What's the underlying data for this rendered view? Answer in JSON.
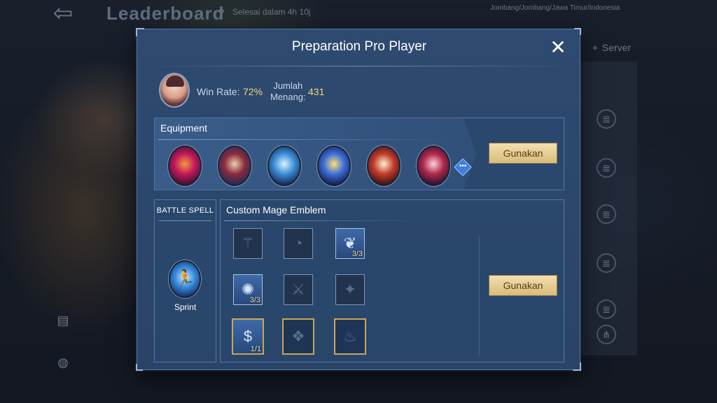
{
  "background": {
    "title": "Leaderboard",
    "timer": "Selesai dalam 4h 10j",
    "location": "Jombang/Jombang/Jawa Timur/Indonesia",
    "server_label": "Server",
    "partial_label": "g"
  },
  "modal": {
    "title": "Preparation Pro Player",
    "close_label": "✕"
  },
  "player": {
    "win_rate_label": "Win Rate:",
    "win_rate_value": "72%",
    "wins_label_line1": "Jumlah",
    "wins_label_line2": "Menang:",
    "wins_value": "431"
  },
  "equipment": {
    "title": "Equipment",
    "items": [
      {
        "icon": "wand-item-icon"
      },
      {
        "icon": "spellbook-item-icon"
      },
      {
        "icon": "ice-sword-item-icon"
      },
      {
        "icon": "golden-staff-item-icon"
      },
      {
        "icon": "helmet-item-icon"
      },
      {
        "icon": "blade-item-icon"
      }
    ],
    "more_label": "•••",
    "use_button": "Gunakan"
  },
  "battle_spell": {
    "title": "BATTLE SPELL",
    "spell_name": "Sprint",
    "spell_glyph": "🏃"
  },
  "emblem": {
    "title": "Custom Mage Emblem",
    "use_button": "Gunakan",
    "talents": [
      {
        "icon": "staff-talent-icon",
        "glyph": "⚚",
        "active": false,
        "level": ""
      },
      {
        "icon": "cycle-talent-icon",
        "glyph": "◔",
        "active": false,
        "level": ""
      },
      {
        "icon": "wing-talent-icon",
        "glyph": "❦",
        "active": true,
        "level": "3/3"
      },
      {
        "icon": "burst-talent-icon",
        "glyph": "✺",
        "active": true,
        "level": "3/3"
      },
      {
        "icon": "sword-talent-icon",
        "glyph": "⚔",
        "active": false,
        "level": ""
      },
      {
        "icon": "fist-talent-icon",
        "glyph": "✦",
        "active": false,
        "level": ""
      },
      {
        "icon": "money-bag-talent-icon",
        "glyph": "$",
        "active": true,
        "level": "1/1"
      },
      {
        "icon": "demon-talent-icon",
        "glyph": "❖",
        "active": false,
        "level": ""
      },
      {
        "icon": "flame-talent-icon",
        "glyph": "♨",
        "active": false,
        "level": ""
      }
    ]
  },
  "colors": {
    "accent_gold": "#f1d67a",
    "button_gold": "#d9bb7c",
    "panel_blue": "#2e4a70"
  }
}
